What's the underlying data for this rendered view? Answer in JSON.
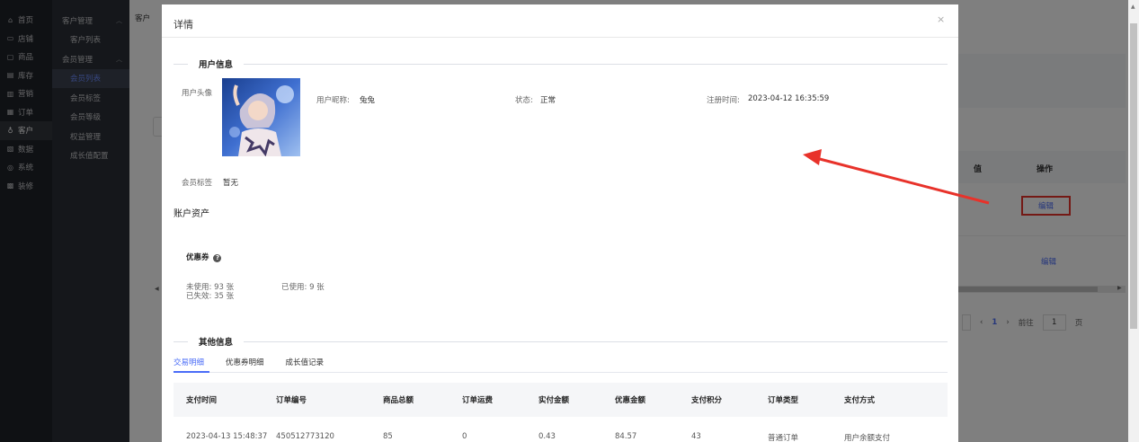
{
  "nav_primary": [
    {
      "icon": "home-icon",
      "glyph": "⌂",
      "label": "首页",
      "active": false
    },
    {
      "icon": "store-icon",
      "glyph": "▭",
      "label": "店铺",
      "active": false
    },
    {
      "icon": "goods-icon",
      "glyph": "▢",
      "label": "商品",
      "active": false
    },
    {
      "icon": "inventory-icon",
      "glyph": "▤",
      "label": "库存",
      "active": false
    },
    {
      "icon": "marketing-icon",
      "glyph": "▥",
      "label": "营销",
      "active": false
    },
    {
      "icon": "order-icon",
      "glyph": "▦",
      "label": "订单",
      "active": false
    },
    {
      "icon": "customer-icon",
      "glyph": "♁",
      "label": "客户",
      "active": true
    },
    {
      "icon": "data-icon",
      "glyph": "▧",
      "label": "数据",
      "active": false
    },
    {
      "icon": "system-icon",
      "glyph": "◎",
      "label": "系统",
      "active": false
    },
    {
      "icon": "decorate-icon",
      "glyph": "▩",
      "label": "装修",
      "active": false
    }
  ],
  "nav_secondary": [
    {
      "label": "客户管理",
      "type": "group",
      "active": false
    },
    {
      "label": "客户列表",
      "type": "sub",
      "active": false
    },
    {
      "label": "会员管理",
      "type": "group",
      "active": false
    },
    {
      "label": "会员列表",
      "type": "sub",
      "active": true
    },
    {
      "label": "会员标签",
      "type": "sub",
      "active": false
    },
    {
      "label": "会员等级",
      "type": "sub",
      "active": false
    },
    {
      "label": "权益管理",
      "type": "sub",
      "active": false
    },
    {
      "label": "成长值配置",
      "type": "sub",
      "active": false
    }
  ],
  "background": {
    "tab_label": "客户",
    "column_partial": "值",
    "column_op": "操作",
    "edit_label": "编辑",
    "pager_current": "1",
    "pager_goto": "前往",
    "pager_input": "1",
    "pager_unit": "页"
  },
  "dialog": {
    "title": "详情",
    "close": "×",
    "user_section": "用户信息",
    "avatar_label": "用户头像",
    "nickname_label": "用户昵称:",
    "nickname": "兔兔",
    "status_label": "状态:",
    "status": "正常",
    "register_label": "注册时间:",
    "register_time": "2023-04-12 16:35:59",
    "member_tag_label": "会员标签",
    "member_tag": "暂无",
    "assets_title": "账户资产",
    "coupon_title": "优惠券",
    "coupon_unused": "未使用: 93 张",
    "coupon_used": "已使用: 9 张",
    "coupon_expired": "已失效: 35 张",
    "other_section": "其他信息",
    "tabs": [
      "交易明细",
      "优惠券明细",
      "成长值记录"
    ],
    "table_headers": [
      "支付时间",
      "订单编号",
      "商品总额",
      "订单运费",
      "实付金额",
      "优惠金额",
      "支付积分",
      "订单类型",
      "支付方式"
    ],
    "rows": [
      [
        "2023-04-13 15:48:37",
        "450512773120",
        "85",
        "0",
        "0.43",
        "84.57",
        "43",
        "普通订单",
        "用户余额支付"
      ]
    ]
  },
  "colors": {
    "accent": "#4a6cf7",
    "annotation_red": "#e8322a"
  }
}
